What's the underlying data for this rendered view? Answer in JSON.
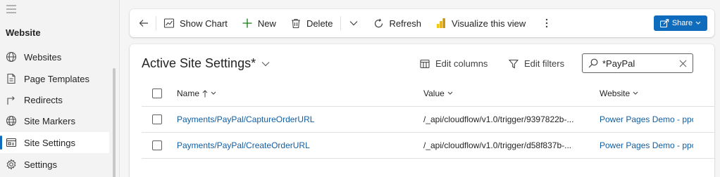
{
  "sidebar": {
    "area_title": "Website",
    "items": [
      {
        "label": "Websites",
        "icon": "globe-icon"
      },
      {
        "label": "Page Templates",
        "icon": "page-template-icon"
      },
      {
        "label": "Redirects",
        "icon": "redirect-icon"
      },
      {
        "label": "Site Markers",
        "icon": "site-marker-icon"
      },
      {
        "label": "Site Settings",
        "icon": "site-settings-icon",
        "active": true
      },
      {
        "label": "Settings",
        "icon": "gear-icon"
      }
    ]
  },
  "toolbar": {
    "show_chart": "Show Chart",
    "new": "New",
    "delete": "Delete",
    "refresh": "Refresh",
    "visualize": "Visualize this view",
    "share": "Share"
  },
  "view": {
    "title": "Active Site Settings*",
    "edit_columns": "Edit columns",
    "edit_filters": "Edit filters",
    "search_value": "*PayPal"
  },
  "grid": {
    "columns": [
      "Name",
      "Value",
      "Website"
    ],
    "rows": [
      {
        "name": "Payments/PayPal/CaptureOrderURL",
        "value": "/_api/cloudflow/v1.0/trigger/9397822b-...",
        "website": "Power Pages Demo - ppo"
      },
      {
        "name": "Payments/PayPal/CreateOrderURL",
        "value": "/_api/cloudflow/v1.0/trigger/d58f837b-...",
        "website": "Power Pages Demo - ppo"
      }
    ]
  },
  "colors": {
    "accent": "#0f6cbd",
    "link": "#115ea3"
  }
}
